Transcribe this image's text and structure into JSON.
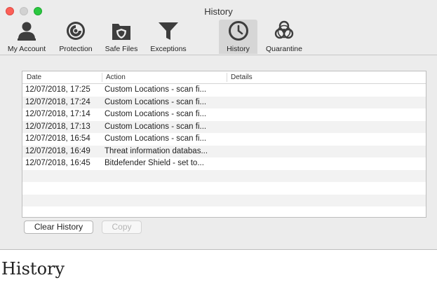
{
  "window": {
    "title": "History"
  },
  "toolbar": {
    "items": [
      {
        "label": "My Account",
        "icon": "person-icon"
      },
      {
        "label": "Protection",
        "icon": "shield-swirl-icon"
      },
      {
        "label": "Safe Files",
        "icon": "folder-shield-icon"
      },
      {
        "label": "Exceptions",
        "icon": "filter-icon"
      },
      {
        "label": "History",
        "icon": "clock-icon",
        "active": true
      },
      {
        "label": "Quarantine",
        "icon": "biohazard-icon"
      }
    ]
  },
  "table": {
    "columns": [
      "Date",
      "Action",
      "Details"
    ],
    "rows": [
      {
        "date": "12/07/2018, 17:25",
        "action": "Custom Locations - scan fi...",
        "details": ""
      },
      {
        "date": "12/07/2018, 17:24",
        "action": "Custom Locations - scan fi...",
        "details": ""
      },
      {
        "date": "12/07/2018, 17:14",
        "action": "Custom Locations - scan fi...",
        "details": ""
      },
      {
        "date": "12/07/2018, 17:13",
        "action": "Custom Locations - scan fi...",
        "details": ""
      },
      {
        "date": "12/07/2018, 16:54",
        "action": "Custom Locations - scan fi...",
        "details": ""
      },
      {
        "date": "12/07/2018, 16:49",
        "action": "Threat information databas...",
        "details": ""
      },
      {
        "date": "12/07/2018, 16:45",
        "action": "Bitdefender Shield - set to...",
        "details": ""
      }
    ]
  },
  "buttons": {
    "clear_history": "Clear History",
    "copy": "Copy"
  },
  "caption": "History",
  "colors": {
    "close": "#fc5f57",
    "maximize": "#2bc840",
    "icon": "#3d3d3d",
    "active_tab": "#d6d6d6"
  }
}
